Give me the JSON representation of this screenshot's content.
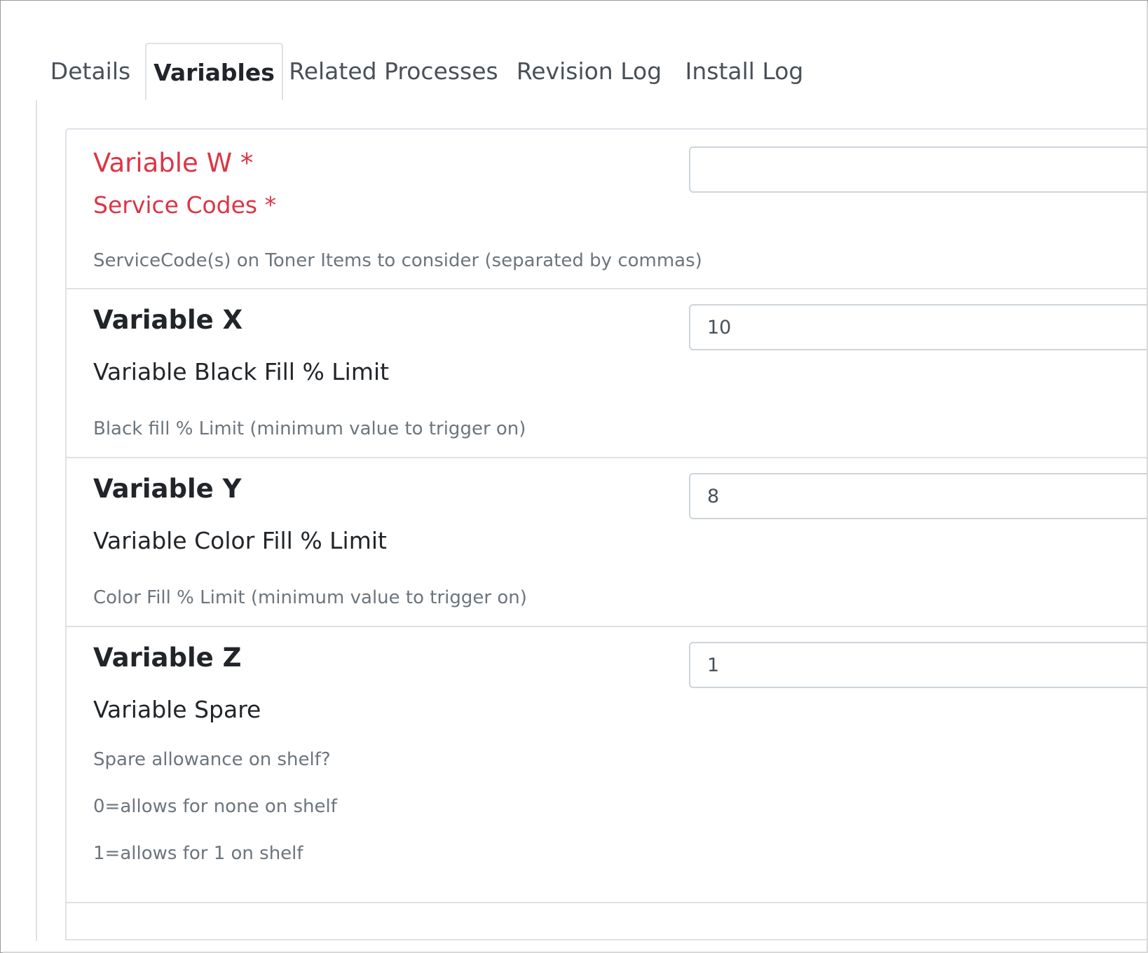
{
  "tabs": [
    {
      "label": "Details"
    },
    {
      "label": "Variables"
    },
    {
      "label": "Related Processes"
    },
    {
      "label": "Revision Log"
    },
    {
      "label": "Install Log"
    }
  ],
  "active_tab": "Variables",
  "variables": [
    {
      "title": "Variable W",
      "required_mark": "*",
      "label": "Service Codes",
      "help": [
        "ServiceCode(s) on Toner Items to consider (separated by commas)"
      ],
      "value": "",
      "required": true
    },
    {
      "title": "Variable X",
      "label": "Variable Black Fill % Limit",
      "help": [
        "Black fill % Limit (minimum value to trigger on)"
      ],
      "value": "10",
      "required": false
    },
    {
      "title": "Variable Y",
      "label": "Variable Color Fill % Limit",
      "help": [
        "Color Fill % Limit (minimum value to trigger on)"
      ],
      "value": "8",
      "required": false
    },
    {
      "title": "Variable Z",
      "label": "Variable Spare",
      "help": [
        "Spare allowance on shelf?",
        "0=allows for none on shelf",
        "1=allows for 1 on shelf"
      ],
      "value": "1",
      "required": false
    }
  ],
  "colors": {
    "required": "#dc3545",
    "muted": "#6c757d",
    "border": "#dee2e6"
  }
}
